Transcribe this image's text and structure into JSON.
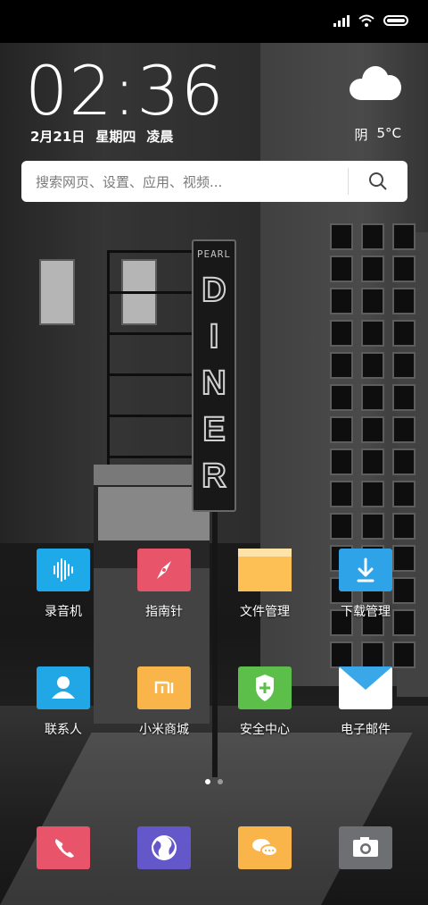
{
  "status_bar": {
    "icons": [
      "signal-icon",
      "wifi-icon",
      "battery-icon"
    ]
  },
  "clock": {
    "time": "02:36",
    "date": "2月21日",
    "weekday": "星期四",
    "period": "凌晨"
  },
  "weather": {
    "condition": "阴",
    "temperature": "5°C",
    "icon": "cloud-icon"
  },
  "search": {
    "placeholder": "搜索网页、设置、应用、视频..."
  },
  "wallpaper": {
    "sign_small": "PEARL",
    "sign_big": "DINER"
  },
  "apps": [
    {
      "label": "录音机",
      "icon": "recorder-icon",
      "color": "#1ea9e8"
    },
    {
      "label": "指南针",
      "icon": "compass-icon",
      "color": "#e8556a"
    },
    {
      "label": "文件管理",
      "icon": "folder-icon",
      "color": "#fcc055"
    },
    {
      "label": "下载管理",
      "icon": "download-icon",
      "color": "#2ea3e8"
    },
    {
      "label": "联系人",
      "icon": "contacts-icon",
      "color": "#21a7e6"
    },
    {
      "label": "小米商城",
      "icon": "mi-store-icon",
      "color": "#f9b54a"
    },
    {
      "label": "安全中心",
      "icon": "security-icon",
      "color": "#5bbf4a"
    },
    {
      "label": "电子邮件",
      "icon": "email-icon",
      "color": "#ffffff"
    }
  ],
  "dock": [
    {
      "icon": "phone-icon",
      "color": "#e8556a"
    },
    {
      "icon": "browser-icon",
      "color": "#6357c9"
    },
    {
      "icon": "messages-icon",
      "color": "#f9b54a"
    },
    {
      "icon": "camera-icon",
      "color": "#6d6f73"
    }
  ],
  "page_indicator": {
    "pages": 2,
    "current": 1
  }
}
